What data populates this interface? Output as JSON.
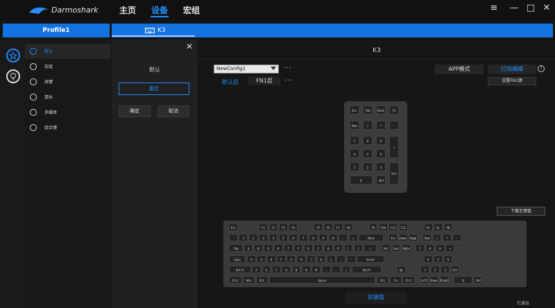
{
  "header": {
    "logo_text": "Darmoshark",
    "nav": [
      "主页",
      "设备",
      "宏组"
    ],
    "active_nav": 1,
    "window_controls": {
      "menu": "≡",
      "minimize": "—",
      "maximize": "□",
      "close": "✕"
    }
  },
  "profile_bar": {
    "label": "Profile1"
  },
  "device_tab": {
    "icon": "keyboard-icon",
    "label": "K3"
  },
  "side_icons": [
    "keyboard-star-icon",
    "bulb-icon"
  ],
  "menu": {
    "items": [
      {
        "label": "默认",
        "icon": "target-icon",
        "active": true
      },
      {
        "label": "宏组",
        "icon": "macro-icon"
      },
      {
        "label": "改键",
        "icon": "remap-icon"
      },
      {
        "label": "鼠标",
        "icon": "mouse-icon"
      },
      {
        "label": "多媒体",
        "icon": "play-icon"
      },
      {
        "label": "组合键",
        "icon": "combo-icon"
      }
    ]
  },
  "panel": {
    "close": "✕",
    "title": "默认",
    "clear": "置空",
    "confirm": "确定",
    "cancel": "取消"
  },
  "main": {
    "title": "K3",
    "config": "NewConfig1",
    "dots": "···",
    "layer_default": "默认层",
    "layer_fn1": "FN1层",
    "app_mode": "APP模式",
    "led_edit": "灯效编辑",
    "help": "?",
    "set_fn1": "设置FN1键",
    "download": "下载至键盘",
    "soft_kb": "软键盘",
    "watermark": "亿速云"
  },
  "numpad_keys": [
    [
      "Esc",
      "Tab",
      "Back",
      "Fn"
    ],
    [
      "Num",
      "/",
      "*",
      "-"
    ],
    [
      "7",
      "8",
      "9",
      "+"
    ],
    [
      "4",
      "5",
      "6"
    ],
    [
      "1",
      "2",
      "3",
      "Ent"
    ],
    [
      "0",
      ".Del"
    ]
  ],
  "keyboard_rows": [
    [
      "Esc",
      "F1",
      "F2",
      "F3",
      "F4",
      "F5",
      "F6",
      "F7",
      "F8",
      "F9",
      "F10",
      "F11",
      "F12",
      "Pt",
      "SL",
      "PB"
    ],
    [
      "`",
      "1",
      "2",
      "3",
      "4",
      "5",
      "6",
      "7",
      "8",
      "9",
      "0",
      "-",
      "=",
      "Back",
      "Ins",
      "Home",
      "PgUp",
      "Num",
      "/",
      "*",
      "-"
    ],
    [
      "Tab",
      "Q",
      "W",
      "E",
      "R",
      "T",
      "Y",
      "U",
      "I",
      "O",
      "P",
      "[",
      "]",
      "\\",
      "Del",
      "End",
      "PgDn",
      "7",
      "8",
      "9",
      "+"
    ],
    [
      "Caps",
      "A",
      "S",
      "D",
      "F",
      "G",
      "H",
      "J",
      "K",
      "L",
      ";",
      "'",
      "Enter",
      "4",
      "5",
      "6"
    ],
    [
      "Shift",
      "Z",
      "X",
      "C",
      "V",
      "B",
      "N",
      "M",
      ",",
      ".",
      "/",
      "Shift",
      "Up",
      "1",
      "2",
      "3",
      "Ent"
    ],
    [
      "Ctrl",
      "Win",
      "Alt",
      "Space",
      "Alt",
      "Fn",
      "Ctrl",
      "Left",
      "Down",
      "Right",
      "0",
      ".Del"
    ]
  ]
}
